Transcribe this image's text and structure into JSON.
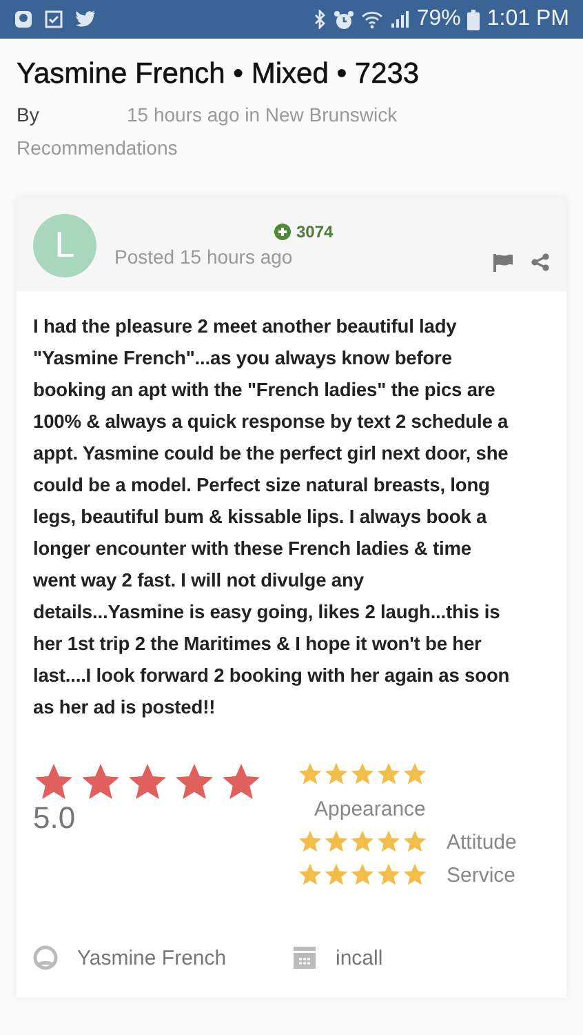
{
  "status_bar": {
    "battery": "79%",
    "time": "1:01 PM"
  },
  "post": {
    "title": "Yasmine French • Mixed • 7233",
    "by": "By",
    "meta": "15 hours ago in New Brunswick",
    "category": "Recommendations"
  },
  "review": {
    "avatar_letter": "L",
    "points": "3074",
    "posted": "Posted 15 hours ago",
    "body": "I had the pleasure 2 meet another beautiful lady\n\"Yasmine French\"...as you always know before\nbooking an apt with the \"French ladies\" the pics are\n100% & always a quick response by text 2 schedule a\nappt. Yasmine could be the perfect girl next door, she\ncould be a model.  Perfect size  natural breasts, long\nlegs, beautiful bum & kissable lips. I always book a\nlonger encounter with these French ladies & time\nwent way 2 fast.  I will not divulge any\ndetails...Yasmine is easy going, likes 2 laugh...this is\nher 1st trip 2 the Maritimes & I hope it won't be her\nlast....I look forward 2 booking with her again as soon\nas her ad is posted!!",
    "overall": {
      "stars": 5,
      "score": "5.0"
    },
    "categories": [
      {
        "label": "Appearance",
        "stars": 5,
        "kind": "below"
      },
      {
        "label": "Attitude",
        "stars": 5,
        "kind": "inline"
      },
      {
        "label": "Service",
        "stars": 5,
        "kind": "inline"
      }
    ],
    "details": [
      {
        "kind": "person",
        "text": "Yasmine French"
      },
      {
        "kind": "calendar",
        "text": "incall"
      }
    ]
  }
}
